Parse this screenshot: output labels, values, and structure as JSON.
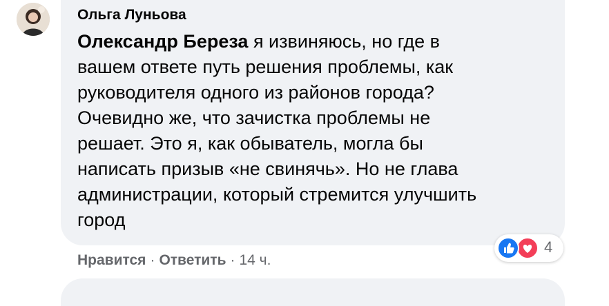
{
  "comment": {
    "author": "Ольга Луньова",
    "mention": "Олександр Береза",
    "text_lines": [
      " я извиняюсь, но где в",
      "вашем ответе путь решения проблемы, как",
      "руководителя одного из районов города?",
      "Очевидно же, что зачистка проблемы не",
      "решает. Это я, как обыватель, могла бы",
      "написать призыв «не свинячь». Но не глава",
      "администрации, который стремится улучшить",
      "город"
    ],
    "reaction_count": "4",
    "reaction_icons": [
      "like-icon",
      "love-icon"
    ],
    "actions": {
      "like_label": "Нравится",
      "reply_label": "Ответить",
      "separator": "·",
      "time": "14 ч."
    }
  },
  "colors": {
    "bubble_bg": "#f0f2f5",
    "secondary_text": "#65676b",
    "like_blue": "#1877f2",
    "love_red": "#f33e58"
  }
}
